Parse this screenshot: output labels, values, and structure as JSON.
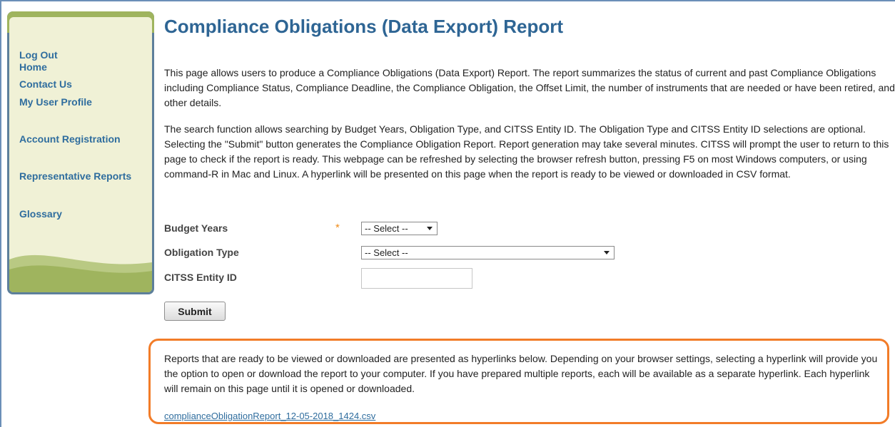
{
  "sidebar": {
    "links": [
      "Log Out",
      "Home",
      "Contact Us",
      "My User Profile",
      "Account Registration",
      "Representative Reports",
      "Glossary"
    ]
  },
  "page": {
    "title": "Compliance Obligations (Data Export) Report",
    "intro": "This page allows users to produce a Compliance Obligations (Data Export) Report. The report summarizes the status of current and past Compliance Obligations including Compliance Status, Compliance Deadline, the Compliance Obligation, the Offset Limit, the number of instruments that are needed or have been retired, and other details.",
    "search_info": "The search function allows searching by Budget Years, Obligation Type, and CITSS Entity ID. The Obligation Type and CITSS Entity ID selections are optional. Selecting the \"Submit\" button generates the Compliance Obligation Report. Report generation may take several minutes. CITSS will prompt the user to return to this page to check if the report is ready. This webpage can be refreshed by selecting the browser refresh button, pressing F5 on most Windows computers, or using command-R in Mac and Linux. A hyperlink will be presented on this page when the report is ready to be viewed or downloaded in CSV format."
  },
  "form": {
    "budget_years_label": "Budget Years",
    "required_marker": "*",
    "budget_years_value": "-- Select --",
    "obligation_type_label": "Obligation Type",
    "obligation_type_value": "-- Select --",
    "entity_id_label": "CITSS Entity ID",
    "entity_id_value": "",
    "submit_label": "Submit"
  },
  "reports": {
    "info": "Reports that are ready to be viewed or downloaded are presented as hyperlinks below. Depending on your browser settings, selecting a hyperlink will provide you the option to open or download the report to your computer. If you have prepared multiple reports, each will be available as a separate hyperlink. Each hyperlink will remain on this page until it is opened or downloaded.",
    "link": "complianceObligationReport_12-05-2018_1424.csv"
  },
  "colors": {
    "accent_orange": "#f27c28",
    "link_blue": "#2f6d9e",
    "sidebar_bg": "#f0f1d6",
    "sidebar_frame": "#5d7f9b",
    "sidebar_green": "#9fb45e"
  }
}
